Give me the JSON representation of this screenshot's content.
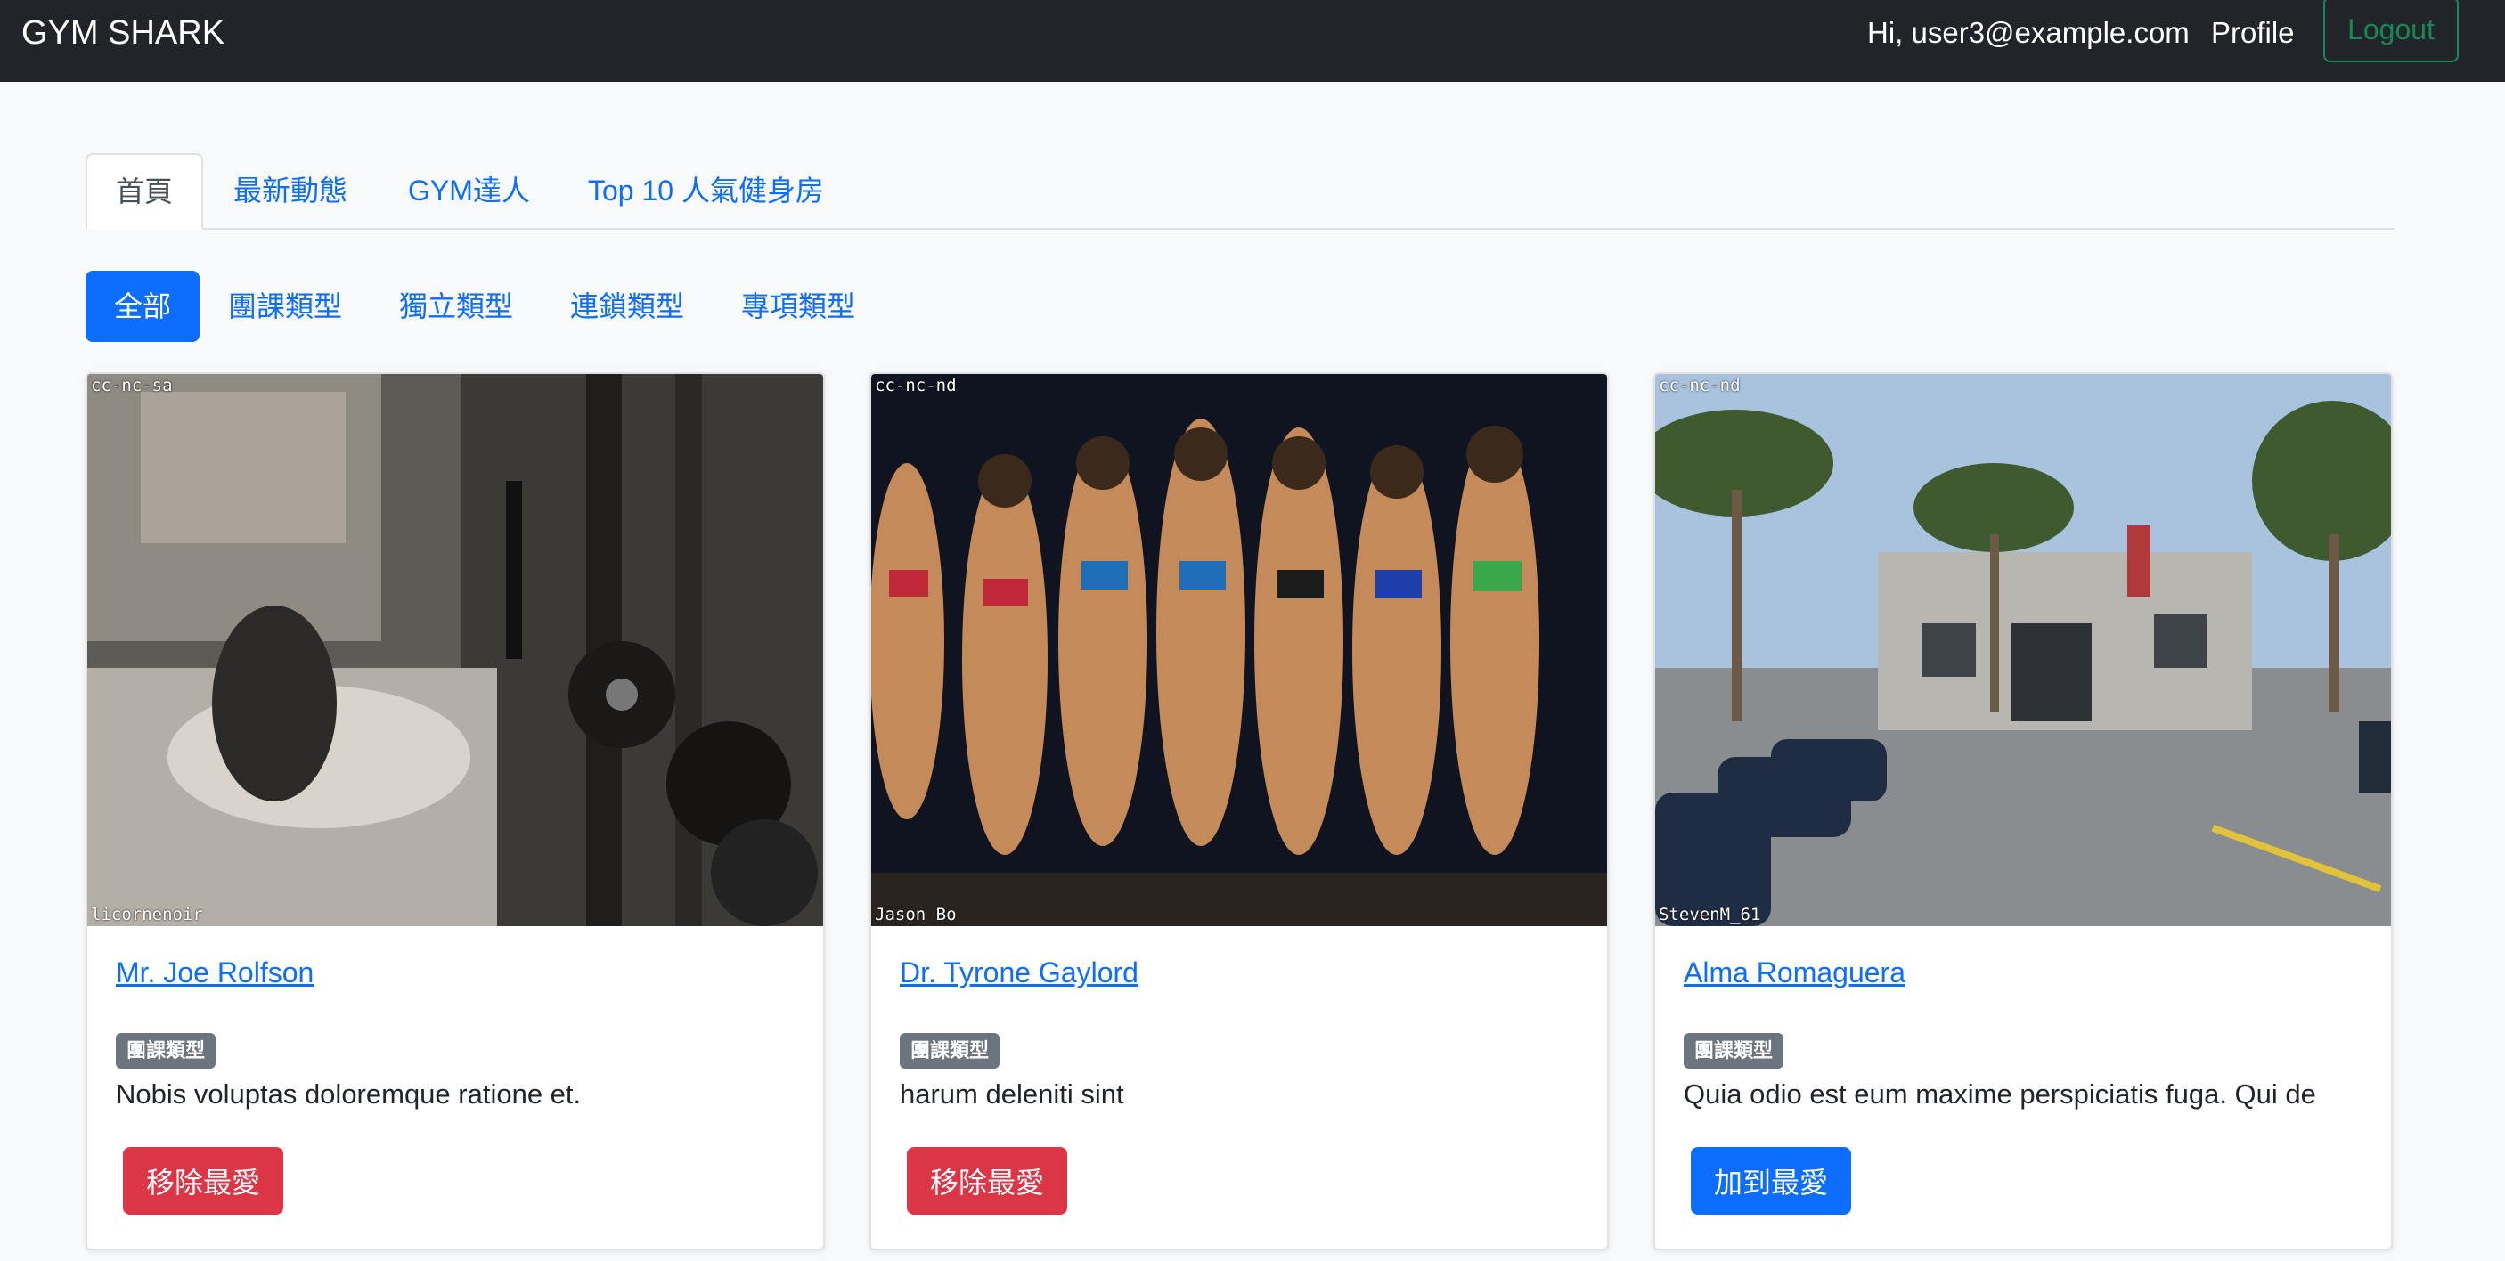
{
  "navbar": {
    "brand": "GYM SHARK",
    "greeting": "Hi, user3@example.com",
    "profile_label": "Profile",
    "logout_label": "Logout"
  },
  "main_tabs": [
    {
      "label": "首頁",
      "active": true
    },
    {
      "label": "最新動態",
      "active": false
    },
    {
      "label": "GYM達人",
      "active": false
    },
    {
      "label": "Top 10 人氣健身房",
      "active": false
    }
  ],
  "filters": [
    {
      "label": "全部",
      "active": true
    },
    {
      "label": "團課類型",
      "active": false
    },
    {
      "label": "獨立類型",
      "active": false
    },
    {
      "label": "連鎖類型",
      "active": false
    },
    {
      "label": "專項類型",
      "active": false
    }
  ],
  "cards": [
    {
      "title": "Mr. Joe Rolfson",
      "category": "團課類型",
      "description": "Nobis voluptas doloremque ratione et.",
      "button_label": "移除最愛",
      "license": "cc-nc-sa",
      "photo_credit": "licornenoir"
    },
    {
      "title": "Dr. Tyrone Gaylord",
      "category": "團課類型",
      "description": "harum deleniti sint",
      "button_label": "移除最愛",
      "license": "cc-nc-nd",
      "photo_credit": "Jason Bo"
    },
    {
      "title": "Alma Romaguera",
      "category": "團課類型",
      "description": "Quia odio est eum maxime perspiciatis fuga. Qui de",
      "button_label": "加到最愛",
      "license": "cc-nc-nd",
      "photo_credit": "StevenM_61"
    }
  ],
  "colors": {
    "navbar_bg": "#212529",
    "primary": "#0d6efd",
    "danger": "#dc3545",
    "success": "#198754",
    "badge": "#6c757d"
  }
}
